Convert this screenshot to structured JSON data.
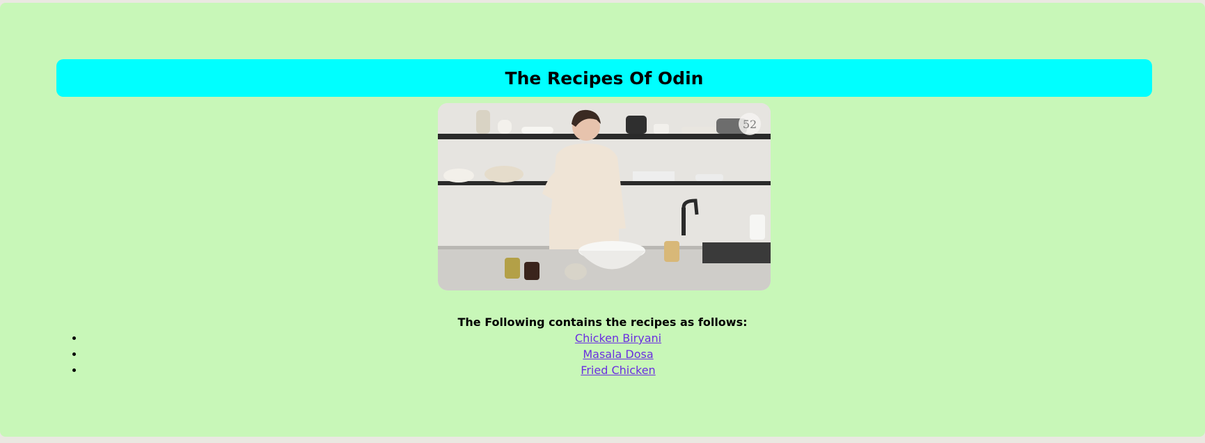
{
  "header": {
    "title": "The Recipes Of Odin"
  },
  "hero_image": {
    "description_icon": "cook-in-kitchen-image",
    "watermark": "52"
  },
  "intro": {
    "text": "The Following contains the recipes as follows:"
  },
  "recipes": [
    {
      "label": "Chicken Biryani"
    },
    {
      "label": "Masala Dosa"
    },
    {
      "label": "Fried Chicken"
    }
  ],
  "colors": {
    "page_bg": "#c8f7b8",
    "title_bg": "#00ffff",
    "link": "#6a2ee0"
  }
}
